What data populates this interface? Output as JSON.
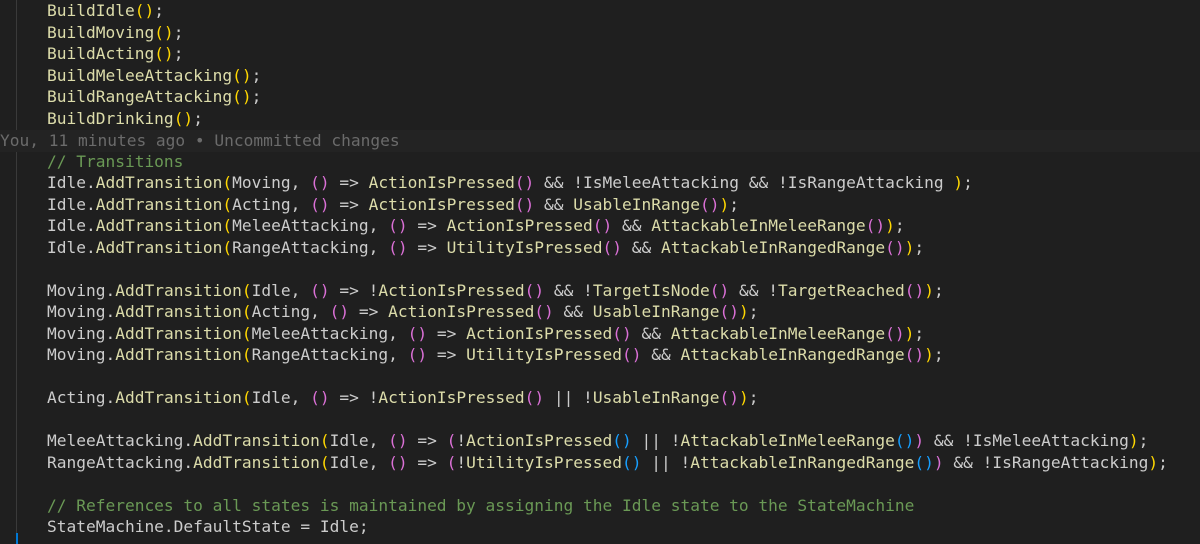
{
  "editor": {
    "colors": {
      "background": "#1f1f1f",
      "method": "#dcdcaa",
      "identifier": "#cccccc",
      "comment": "#6a9955",
      "bracket_level_1": "#ffd700",
      "bracket_level_2": "#da70d6",
      "bracket_level_3": "#179fff",
      "blame": "#6b6b6b"
    },
    "blame_annotation": "You, 11 minutes ago • Uncommitted changes",
    "lines": [
      {
        "indent": "    ",
        "tokens": [
          {
            "t": "BuildIdle",
            "c": "f"
          },
          {
            "t": "()",
            "c": "b1"
          },
          {
            "t": ";",
            "c": "v"
          }
        ]
      },
      {
        "indent": "    ",
        "tokens": [
          {
            "t": "BuildMoving",
            "c": "f"
          },
          {
            "t": "()",
            "c": "b1"
          },
          {
            "t": ";",
            "c": "v"
          }
        ]
      },
      {
        "indent": "    ",
        "tokens": [
          {
            "t": "BuildActing",
            "c": "f"
          },
          {
            "t": "()",
            "c": "b1"
          },
          {
            "t": ";",
            "c": "v"
          }
        ]
      },
      {
        "indent": "    ",
        "tokens": [
          {
            "t": "BuildMeleeAttacking",
            "c": "f"
          },
          {
            "t": "()",
            "c": "b1"
          },
          {
            "t": ";",
            "c": "v"
          }
        ]
      },
      {
        "indent": "    ",
        "tokens": [
          {
            "t": "BuildRangeAttacking",
            "c": "f"
          },
          {
            "t": "()",
            "c": "b1"
          },
          {
            "t": ";",
            "c": "v"
          }
        ]
      },
      {
        "indent": "    ",
        "tokens": [
          {
            "t": "BuildDrinking",
            "c": "f"
          },
          {
            "t": "()",
            "c": "b1"
          },
          {
            "t": ";",
            "c": "v"
          }
        ]
      },
      {
        "blame": true,
        "tokens": []
      },
      {
        "indent": "    ",
        "tokens": [
          {
            "t": "// Transitions",
            "c": "cm"
          }
        ]
      },
      {
        "indent": "    ",
        "tokens": [
          {
            "t": "Idle.",
            "c": "v"
          },
          {
            "t": "AddTransition",
            "c": "f"
          },
          {
            "t": "(",
            "c": "b1"
          },
          {
            "t": "Moving, ",
            "c": "v"
          },
          {
            "t": "()",
            "c": "b2"
          },
          {
            "t": " => ",
            "c": "v"
          },
          {
            "t": "ActionIsPressed",
            "c": "f"
          },
          {
            "t": "()",
            "c": "b2"
          },
          {
            "t": " && !IsMeleeAttacking && !IsRangeAttacking ",
            "c": "v"
          },
          {
            "t": ")",
            "c": "b1"
          },
          {
            "t": ";",
            "c": "v"
          }
        ]
      },
      {
        "indent": "    ",
        "tokens": [
          {
            "t": "Idle.",
            "c": "v"
          },
          {
            "t": "AddTransition",
            "c": "f"
          },
          {
            "t": "(",
            "c": "b1"
          },
          {
            "t": "Acting, ",
            "c": "v"
          },
          {
            "t": "()",
            "c": "b2"
          },
          {
            "t": " => ",
            "c": "v"
          },
          {
            "t": "ActionIsPressed",
            "c": "f"
          },
          {
            "t": "()",
            "c": "b2"
          },
          {
            "t": " && ",
            "c": "v"
          },
          {
            "t": "UsableInRange",
            "c": "f"
          },
          {
            "t": "()",
            "c": "b2"
          },
          {
            "t": ")",
            "c": "b1"
          },
          {
            "t": ";",
            "c": "v"
          }
        ]
      },
      {
        "indent": "    ",
        "tokens": [
          {
            "t": "Idle.",
            "c": "v"
          },
          {
            "t": "AddTransition",
            "c": "f"
          },
          {
            "t": "(",
            "c": "b1"
          },
          {
            "t": "MeleeAttacking, ",
            "c": "v"
          },
          {
            "t": "()",
            "c": "b2"
          },
          {
            "t": " => ",
            "c": "v"
          },
          {
            "t": "ActionIsPressed",
            "c": "f"
          },
          {
            "t": "()",
            "c": "b2"
          },
          {
            "t": " && ",
            "c": "v"
          },
          {
            "t": "AttackableInMeleeRange",
            "c": "f"
          },
          {
            "t": "()",
            "c": "b2"
          },
          {
            "t": ")",
            "c": "b1"
          },
          {
            "t": ";",
            "c": "v"
          }
        ]
      },
      {
        "indent": "    ",
        "tokens": [
          {
            "t": "Idle.",
            "c": "v"
          },
          {
            "t": "AddTransition",
            "c": "f"
          },
          {
            "t": "(",
            "c": "b1"
          },
          {
            "t": "RangeAttacking, ",
            "c": "v"
          },
          {
            "t": "()",
            "c": "b2"
          },
          {
            "t": " => ",
            "c": "v"
          },
          {
            "t": "UtilityIsPressed",
            "c": "f"
          },
          {
            "t": "()",
            "c": "b2"
          },
          {
            "t": " && ",
            "c": "v"
          },
          {
            "t": "AttackableInRangedRange",
            "c": "f"
          },
          {
            "t": "()",
            "c": "b2"
          },
          {
            "t": ")",
            "c": "b1"
          },
          {
            "t": ";",
            "c": "v"
          }
        ]
      },
      {
        "indent": "",
        "tokens": []
      },
      {
        "indent": "    ",
        "tokens": [
          {
            "t": "Moving.",
            "c": "v"
          },
          {
            "t": "AddTransition",
            "c": "f"
          },
          {
            "t": "(",
            "c": "b1"
          },
          {
            "t": "Idle, ",
            "c": "v"
          },
          {
            "t": "()",
            "c": "b2"
          },
          {
            "t": " => !",
            "c": "v"
          },
          {
            "t": "ActionIsPressed",
            "c": "f"
          },
          {
            "t": "()",
            "c": "b2"
          },
          {
            "t": " && !",
            "c": "v"
          },
          {
            "t": "TargetIsNode",
            "c": "f"
          },
          {
            "t": "()",
            "c": "b2"
          },
          {
            "t": " && !",
            "c": "v"
          },
          {
            "t": "TargetReached",
            "c": "f"
          },
          {
            "t": "()",
            "c": "b2"
          },
          {
            "t": ")",
            "c": "b1"
          },
          {
            "t": ";",
            "c": "v"
          }
        ]
      },
      {
        "indent": "    ",
        "tokens": [
          {
            "t": "Moving.",
            "c": "v"
          },
          {
            "t": "AddTransition",
            "c": "f"
          },
          {
            "t": "(",
            "c": "b1"
          },
          {
            "t": "Acting, ",
            "c": "v"
          },
          {
            "t": "()",
            "c": "b2"
          },
          {
            "t": " => ",
            "c": "v"
          },
          {
            "t": "ActionIsPressed",
            "c": "f"
          },
          {
            "t": "()",
            "c": "b2"
          },
          {
            "t": " && ",
            "c": "v"
          },
          {
            "t": "UsableInRange",
            "c": "f"
          },
          {
            "t": "()",
            "c": "b2"
          },
          {
            "t": ")",
            "c": "b1"
          },
          {
            "t": ";",
            "c": "v"
          }
        ]
      },
      {
        "indent": "    ",
        "tokens": [
          {
            "t": "Moving.",
            "c": "v"
          },
          {
            "t": "AddTransition",
            "c": "f"
          },
          {
            "t": "(",
            "c": "b1"
          },
          {
            "t": "MeleeAttacking, ",
            "c": "v"
          },
          {
            "t": "()",
            "c": "b2"
          },
          {
            "t": " => ",
            "c": "v"
          },
          {
            "t": "ActionIsPressed",
            "c": "f"
          },
          {
            "t": "()",
            "c": "b2"
          },
          {
            "t": " && ",
            "c": "v"
          },
          {
            "t": "AttackableInMeleeRange",
            "c": "f"
          },
          {
            "t": "()",
            "c": "b2"
          },
          {
            "t": ")",
            "c": "b1"
          },
          {
            "t": ";",
            "c": "v"
          }
        ]
      },
      {
        "indent": "    ",
        "tokens": [
          {
            "t": "Moving.",
            "c": "v"
          },
          {
            "t": "AddTransition",
            "c": "f"
          },
          {
            "t": "(",
            "c": "b1"
          },
          {
            "t": "RangeAttacking, ",
            "c": "v"
          },
          {
            "t": "()",
            "c": "b2"
          },
          {
            "t": " => ",
            "c": "v"
          },
          {
            "t": "UtilityIsPressed",
            "c": "f"
          },
          {
            "t": "()",
            "c": "b2"
          },
          {
            "t": " && ",
            "c": "v"
          },
          {
            "t": "AttackableInRangedRange",
            "c": "f"
          },
          {
            "t": "()",
            "c": "b2"
          },
          {
            "t": ")",
            "c": "b1"
          },
          {
            "t": ";",
            "c": "v"
          }
        ]
      },
      {
        "indent": "",
        "tokens": []
      },
      {
        "indent": "    ",
        "tokens": [
          {
            "t": "Acting.",
            "c": "v"
          },
          {
            "t": "AddTransition",
            "c": "f"
          },
          {
            "t": "(",
            "c": "b1"
          },
          {
            "t": "Idle, ",
            "c": "v"
          },
          {
            "t": "()",
            "c": "b2"
          },
          {
            "t": " => !",
            "c": "v"
          },
          {
            "t": "ActionIsPressed",
            "c": "f"
          },
          {
            "t": "()",
            "c": "b2"
          },
          {
            "t": " || !",
            "c": "v"
          },
          {
            "t": "UsableInRange",
            "c": "f"
          },
          {
            "t": "()",
            "c": "b2"
          },
          {
            "t": ")",
            "c": "b1"
          },
          {
            "t": ";",
            "c": "v"
          }
        ]
      },
      {
        "indent": "",
        "tokens": []
      },
      {
        "indent": "    ",
        "tokens": [
          {
            "t": "MeleeAttacking.",
            "c": "v"
          },
          {
            "t": "AddTransition",
            "c": "f"
          },
          {
            "t": "(",
            "c": "b1"
          },
          {
            "t": "Idle, ",
            "c": "v"
          },
          {
            "t": "()",
            "c": "b2"
          },
          {
            "t": " => ",
            "c": "v"
          },
          {
            "t": "(",
            "c": "b2"
          },
          {
            "t": "!",
            "c": "v"
          },
          {
            "t": "ActionIsPressed",
            "c": "f"
          },
          {
            "t": "()",
            "c": "b3"
          },
          {
            "t": " || !",
            "c": "v"
          },
          {
            "t": "AttackableInMeleeRange",
            "c": "f"
          },
          {
            "t": "()",
            "c": "b3"
          },
          {
            "t": ")",
            "c": "b2"
          },
          {
            "t": " && !IsMeleeAttacking",
            "c": "v"
          },
          {
            "t": ")",
            "c": "b1"
          },
          {
            "t": ";",
            "c": "v"
          }
        ]
      },
      {
        "indent": "    ",
        "tokens": [
          {
            "t": "RangeAttacking.",
            "c": "v"
          },
          {
            "t": "AddTransition",
            "c": "f"
          },
          {
            "t": "(",
            "c": "b1"
          },
          {
            "t": "Idle, ",
            "c": "v"
          },
          {
            "t": "()",
            "c": "b2"
          },
          {
            "t": " => ",
            "c": "v"
          },
          {
            "t": "(",
            "c": "b2"
          },
          {
            "t": "!",
            "c": "v"
          },
          {
            "t": "UtilityIsPressed",
            "c": "f"
          },
          {
            "t": "()",
            "c": "b3"
          },
          {
            "t": " || !",
            "c": "v"
          },
          {
            "t": "AttackableInRangedRange",
            "c": "f"
          },
          {
            "t": "()",
            "c": "b3"
          },
          {
            "t": ")",
            "c": "b2"
          },
          {
            "t": " && !IsRangeAttacking",
            "c": "v"
          },
          {
            "t": ")",
            "c": "b1"
          },
          {
            "t": ";",
            "c": "v"
          }
        ]
      },
      {
        "indent": "",
        "tokens": []
      },
      {
        "indent": "    ",
        "tokens": [
          {
            "t": "// References to all states is maintained by assigning the Idle state to the StateMachine",
            "c": "cm"
          }
        ]
      },
      {
        "indent": "    ",
        "tokens": [
          {
            "t": "StateMachine.DefaultState = Idle;",
            "c": "v"
          }
        ]
      }
    ]
  }
}
